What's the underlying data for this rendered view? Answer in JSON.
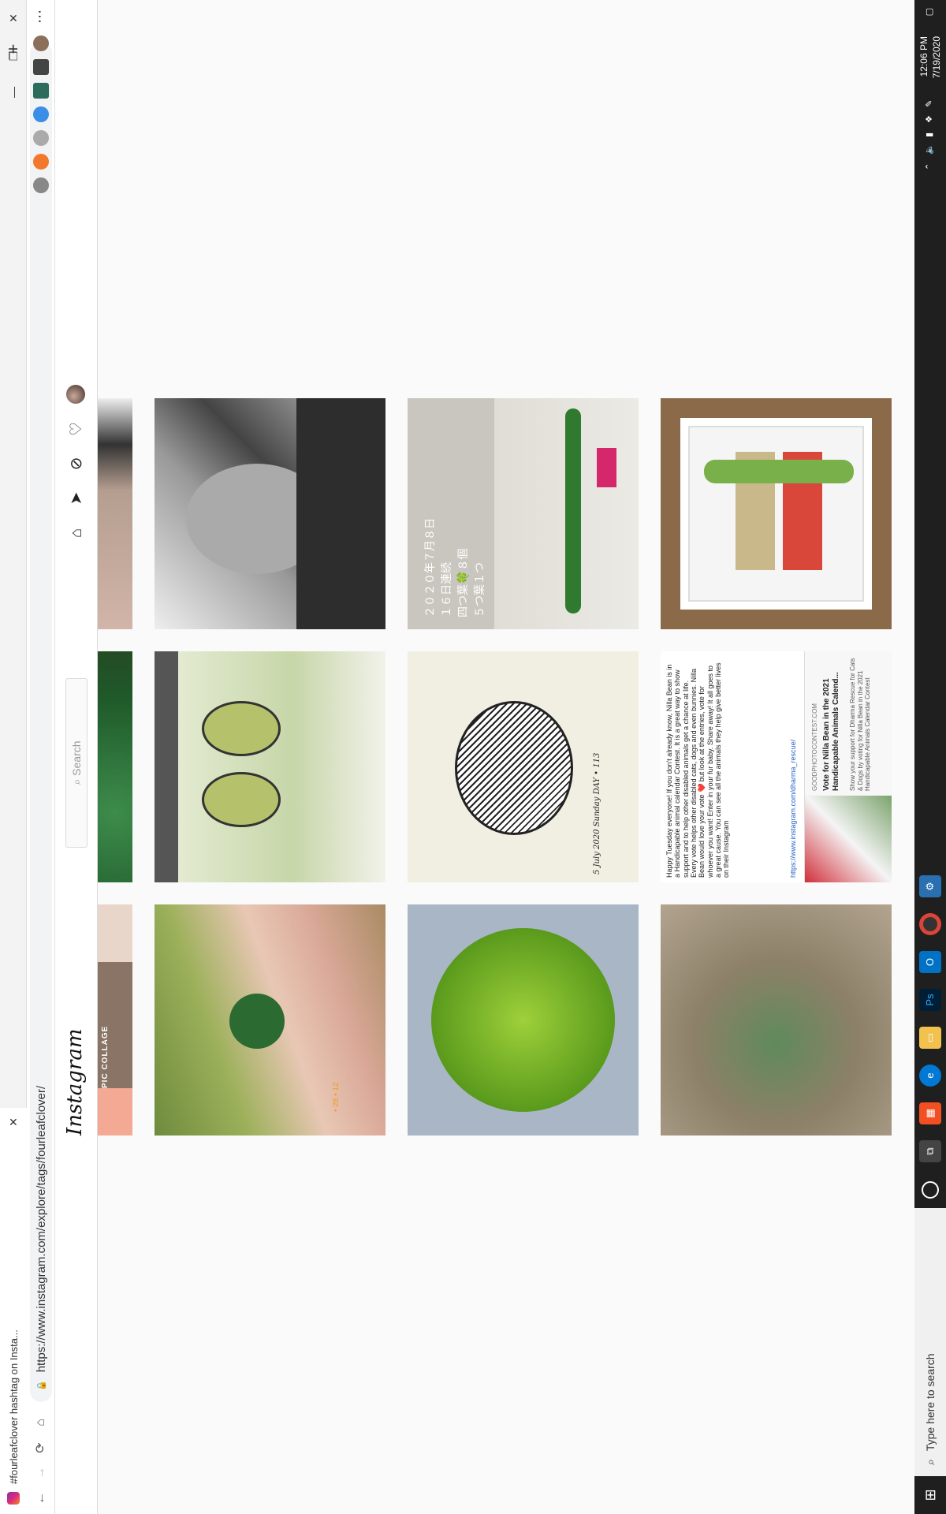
{
  "browser": {
    "tab_title": "#fourleafclover hashtag on Insta...",
    "tab_close": "✕",
    "new_tab": "+",
    "url": "https://www.instagram.com/explore/tags/fourleafclover/",
    "menu": "⋯",
    "window_controls": [
      "—",
      "❐",
      "✕"
    ]
  },
  "instagram": {
    "logo": "Instagram",
    "search_placeholder": "Search",
    "icons": [
      "home-icon",
      "direct-icon",
      "explore-icon",
      "activity-heart-icon",
      "profile-avatar"
    ]
  },
  "posts": {
    "row0": [
      {
        "label": "PIC COLLAGE",
        "alt": "cropped collage"
      },
      {
        "label": "",
        "alt": "clover close-up"
      },
      {
        "label": "",
        "alt": "cropped photo"
      }
    ],
    "row1": [
      {
        "label": "",
        "alt": "hand holding clovers",
        "stamp": "• 28 • 12"
      },
      {
        "label": "",
        "alt": "four-leaf clover earrings"
      },
      {
        "label": "",
        "alt": "black and white portrait"
      }
    ],
    "row2": [
      {
        "label": "",
        "alt": "large four leaf clover"
      },
      {
        "label": "",
        "alt": "clover ink drawing",
        "ink_text": "5 July 2020 Sunday DAY • 113"
      },
      {
        "label": "",
        "alt": "clover photo with japanese text",
        "jp_lines": [
          "２０２０年７月８日",
          "１６日連続",
          "四つ葉🍀８個",
          "５つ葉１つ"
        ]
      }
    ],
    "row3": [
      {
        "label": "",
        "alt": "small clover in grass"
      },
      {
        "alt": "Nilla Bean post",
        "text": "Happy Tuesday everyone! If you don't already know, Nilla Bean is in a Handicapable animal calendar Contest. It is a great way to show support and to help other disabled animals get a chance at life. Every vote helps other disabled cats, dogs and even bunnies. Nilla Bean would love your vote ❤️ but look at the entries, vote for whoever you want! Enter in your fur baby. Share away! It all goes to a great cause. You can see all the animals they help give better lives on their Instagram",
        "link1": "https://www.instagram.com/dharma_rescue/",
        "site": "GOODPHOTOCONTEST.COM",
        "headline": "Vote for Nilla Bean in the 2021 Handicapable Animals Calend...",
        "sub": "Show your support for Dharma Rescue for Cats & Dogs by voting for Nilla Bean in the 2021 Handicapable Animals Calendar Contest"
      },
      {
        "label": "",
        "alt": "framed drawing of couple"
      }
    ]
  },
  "taskbar": {
    "search_placeholder": "Type here to search",
    "time": "12:06 PM",
    "date": "7/19/2020"
  }
}
